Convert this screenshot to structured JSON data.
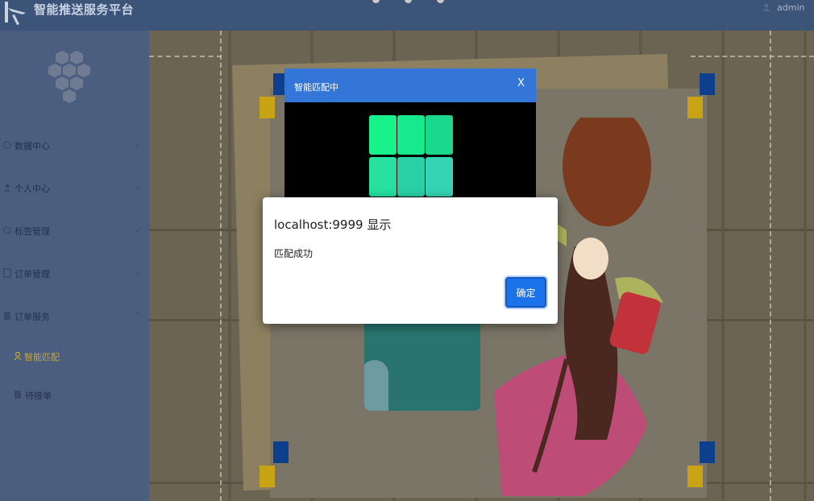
{
  "header": {
    "app_title": "智能推送服务平台",
    "username": "admin"
  },
  "sidebar": {
    "items": [
      {
        "label": "数据中心",
        "icon": "dashboard-icon",
        "expandable": true
      },
      {
        "label": "个人中心",
        "icon": "user-icon",
        "expandable": true
      },
      {
        "label": "标签管理",
        "icon": "tag-icon",
        "expandable": true
      },
      {
        "label": "订单管理",
        "icon": "order-icon",
        "expandable": true
      },
      {
        "label": "订单服务",
        "icon": "service-icon",
        "expandable": true
      }
    ],
    "subitems": [
      {
        "label": "智能匹配",
        "icon": "person-icon",
        "active": true
      },
      {
        "label": "待接单",
        "icon": "list-icon",
        "active": false
      }
    ],
    "active_color": "#c4a53c"
  },
  "match_modal": {
    "title": "智能匹配中",
    "close_label": "X",
    "tile_colors": [
      "#17f28a",
      "#17e98d",
      "#1ad98c",
      "#26e1a0",
      "#2ad1a6",
      "#35d4b4"
    ]
  },
  "alert": {
    "title": "localhost:9999 显示",
    "message": "匹配成功",
    "ok_label": "确定",
    "button_color": "#1a73e8"
  }
}
